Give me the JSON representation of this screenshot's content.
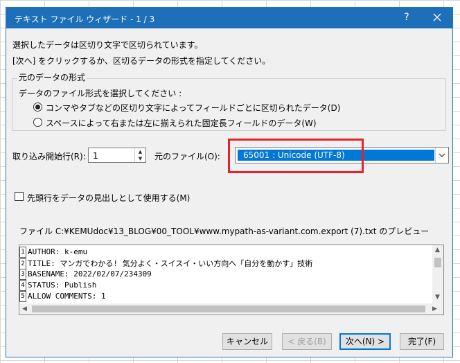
{
  "dialog": {
    "title": "テキスト ファイル ウィザード - 1 / 3",
    "help_glyph": "?",
    "intro_line1": "選択したデータは区切り文字で区切られています。",
    "intro_line2": "[次へ] をクリックするか、区切るデータの形式を指定してください。"
  },
  "source_format": {
    "group_label": "元のデータの形式",
    "prompt": "データのファイル形式を選択してください :",
    "options": [
      {
        "label": "コンマやタブなどの区切り文字によってフィールドごとに区切られたデータ(D)",
        "selected": true
      },
      {
        "label": "スペースによって右または左に揃えられた固定長フィールドのデータ(W)",
        "selected": false
      }
    ]
  },
  "import_start": {
    "label": "取り込み開始行(R):",
    "value": "1"
  },
  "origin": {
    "label": "元のファイル(O):",
    "selected_value": "65001 : Unicode (UTF-8)"
  },
  "headers_checkbox": {
    "label": "先頭行をデータの見出しとして使用する(M)",
    "checked": false
  },
  "preview": {
    "label": "ファイル C:¥KEMUdoc¥13_BLOG¥00_TOOL¥www.mypath-as-variant.com.export (7).txt のプレビュー",
    "lines": [
      {
        "num": "1",
        "text": "AUTHOR: k-emu"
      },
      {
        "num": "2",
        "text": "TITLE: マンガでわかる! 気分よく・スイスイ・いい方向へ「自分を動かす」技術"
      },
      {
        "num": "3",
        "text": "BASENAME: 2022/02/07/234309"
      },
      {
        "num": "4",
        "text": "STATUS: Publish"
      },
      {
        "num": "5",
        "text": "ALLOW COMMENTS: 1"
      }
    ]
  },
  "buttons": {
    "cancel": "キャンセル",
    "back": "< 戻る(B)",
    "next": "次へ(N) >",
    "finish": "完了(F)"
  },
  "colors": {
    "titlebar": "#1e6fb9",
    "selection": "#0078d7",
    "highlight_box": "#e8202a"
  }
}
